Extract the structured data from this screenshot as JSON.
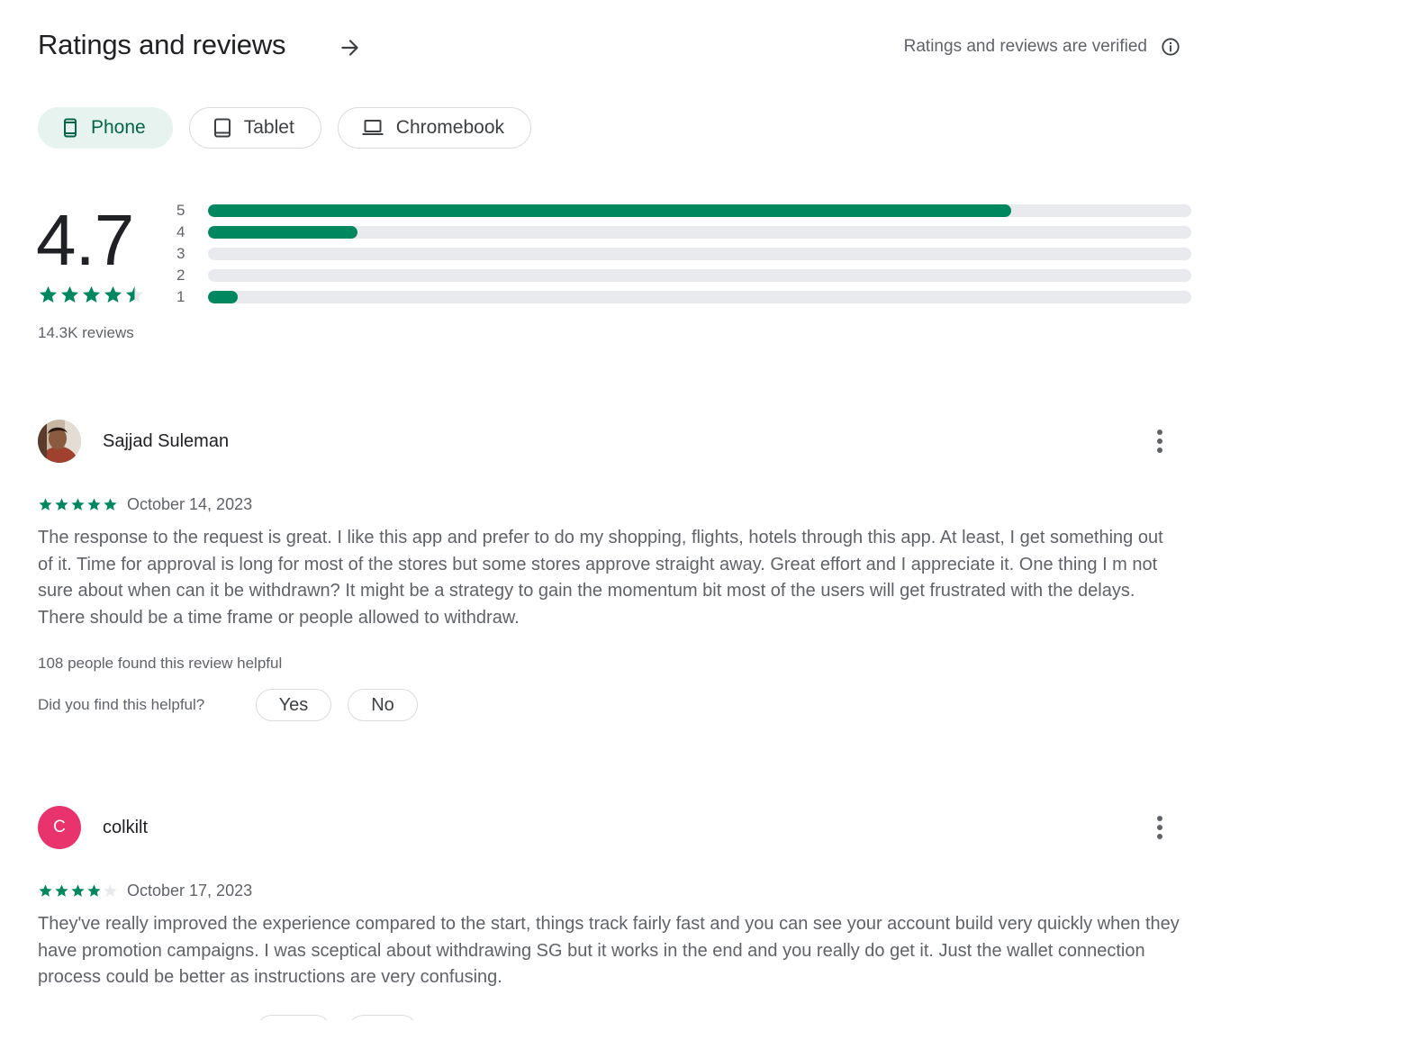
{
  "header": {
    "title": "Ratings and reviews",
    "verified_text": "Ratings and reviews are verified"
  },
  "device_tabs": [
    {
      "label": "Phone",
      "icon": "phone-icon",
      "selected": true
    },
    {
      "label": "Tablet",
      "icon": "tablet-icon",
      "selected": false
    },
    {
      "label": "Chromebook",
      "icon": "laptop-icon",
      "selected": false
    }
  ],
  "summary": {
    "rating": "4.7",
    "stars": 4.5,
    "reviews_count": "14.3K reviews",
    "distribution": [
      {
        "label": "5",
        "fraction": 0.817
      },
      {
        "label": "4",
        "fraction": 0.152
      },
      {
        "label": "3",
        "fraction": 0.0
      },
      {
        "label": "2",
        "fraction": 0.0
      },
      {
        "label": "1",
        "fraction": 0.03
      }
    ]
  },
  "colors": {
    "accent": "#01875f",
    "chip_selected_bg": "#e6f3ef",
    "avatar_colkilt": "#e8336c"
  },
  "reviews": [
    {
      "name": "Sajjad Suleman",
      "avatar": "photo",
      "stars": 5,
      "date": "October 14, 2023",
      "text": "The response to the request is great. I like this app and prefer to do my shopping, flights, hotels through this app. At least, I get something out of it. Time for approval is long for most of the stores but some stores approve straight away. Great effort and I appreciate it. One thing I m not sure about when can it be withdrawn? It might be a strategy to gain the momentum bit most of the users will get frustrated with the delays. There should be a time frame or people allowed to withdraw.",
      "helpful_count": "108 people found this review helpful",
      "helpful_question": "Did you find this helpful?",
      "yes_label": "Yes",
      "no_label": "No"
    },
    {
      "name": "colkilt",
      "avatar": "letter",
      "avatar_letter": "C",
      "stars": 4,
      "date": "October 17, 2023",
      "text": "They've really improved the experience compared to the start, things track fairly fast and you can see your account build very quickly when they have promotion campaigns. I was sceptical about withdrawing SG but it works in the end and you really do get it. Just the wallet connection process could be better as instructions are very confusing."
    }
  ]
}
